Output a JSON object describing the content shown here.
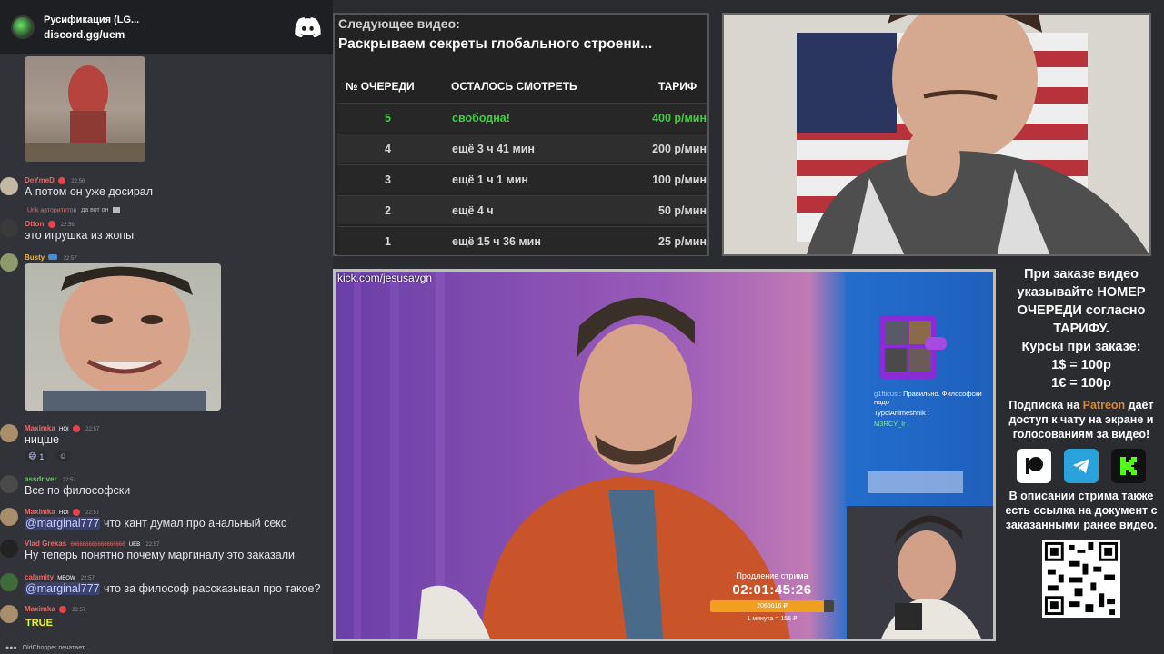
{
  "discord": {
    "server_name": "Русификация (LG...",
    "server_link": "discord.gg/uem",
    "typing": "OldChopper печатает...",
    "messages": [
      {
        "user": "DeYmeD",
        "color": "#e86a6a",
        "time": "22:56",
        "text": "А потом он уже досирал"
      },
      {
        "user": "Otton",
        "color": "#e86a6a",
        "time": "22:56",
        "reply_user": "Unk авторитетов",
        "reply_text": "да вот он",
        "text": "это игрушка из жопы"
      },
      {
        "user": "Busty",
        "color": "#f0b232",
        "time": "22:57",
        "text": ""
      },
      {
        "user": "Maximka",
        "color": "#e86a6a",
        "tag": "HOI",
        "time": "22:57",
        "text": "ницше",
        "reaction_count": "1"
      },
      {
        "user": "assdriver",
        "color": "#6fbf6f",
        "time": "22:51",
        "text": "Все по философски"
      },
      {
        "user": "Maximka",
        "color": "#e86a6a",
        "tag": "HOI",
        "time": "22:57",
        "mention": "@marginal777",
        "text": " что кант думал про анальный секс"
      },
      {
        "user": "Vlad Grekas",
        "color": "#e86a6a",
        "tag_extra": "666666666666666666",
        "tag2": "UEB",
        "time": "22:57",
        "text": "Ну теперь понятно почему маргиналу это заказали"
      },
      {
        "user": "calamity",
        "color": "#e86a6a",
        "tag": "MEOW",
        "time": "22:57",
        "mention": "@marginal777",
        "text": " что за философ рассказывал про такое?"
      },
      {
        "user": "Maximka",
        "color": "#e86a6a",
        "tag": "HOI",
        "time": "22:57",
        "text": "TRUE"
      }
    ]
  },
  "queue": {
    "next_label": "Следующее видео:",
    "next_title": "Раскрываем секреты глобального строени...",
    "headers": [
      "№ ОЧЕРЕДИ",
      "ОСТАЛОСЬ СМОТРЕТЬ",
      "ТАРИФ"
    ],
    "rows": [
      {
        "num": "5",
        "remaining": "свободна!",
        "rate": "400 р/мин",
        "highlight": true
      },
      {
        "num": "4",
        "remaining": "ещё 3 ч 41 мин",
        "rate": "200 р/мин",
        "highlight": false
      },
      {
        "num": "3",
        "remaining": "ещё 1 ч 1 мин",
        "rate": "100 р/мин",
        "highlight": false
      },
      {
        "num": "2",
        "remaining": "ещё 4 ч",
        "rate": "50 р/мин",
        "highlight": false
      },
      {
        "num": "1",
        "remaining": "ещё 15 ч 36 мин",
        "rate": "25 р/мин",
        "highlight": false
      }
    ],
    "highlight_color": "#3fcf3f"
  },
  "video": {
    "kick_url": "kick.com/jesusavgn",
    "extension_label": "Продление стрима",
    "timer": "02:01:45:26",
    "progress_text": "2065616 ₽",
    "progress": 0.92,
    "rate": "1 минута = 155 ₽",
    "overlay_chat": [
      {
        "user": "g1fticus",
        "text": "Правильно. Философски надо"
      },
      {
        "user": "TypoiAnimeshnik",
        "text": ""
      },
      {
        "user": "M3RCY_lr",
        "text": ""
      }
    ]
  },
  "info": {
    "rules": "При заказе видео указывайте НОМЕР ОЧЕРЕДИ согласно ТАРИФУ.",
    "courses_label": "Курсы при заказе:",
    "usd": "1$ = 100р",
    "eur": "1€ = 100р",
    "sub_before": "Подписка на ",
    "sub_patreon": "Patreon",
    "sub_after": " даёт доступ к чату на экране и голосованиям за видео!",
    "desc": "В описании стрима также есть ссылка на документ с заказанными ранее видео.",
    "patreon_color": "#d4893a"
  }
}
